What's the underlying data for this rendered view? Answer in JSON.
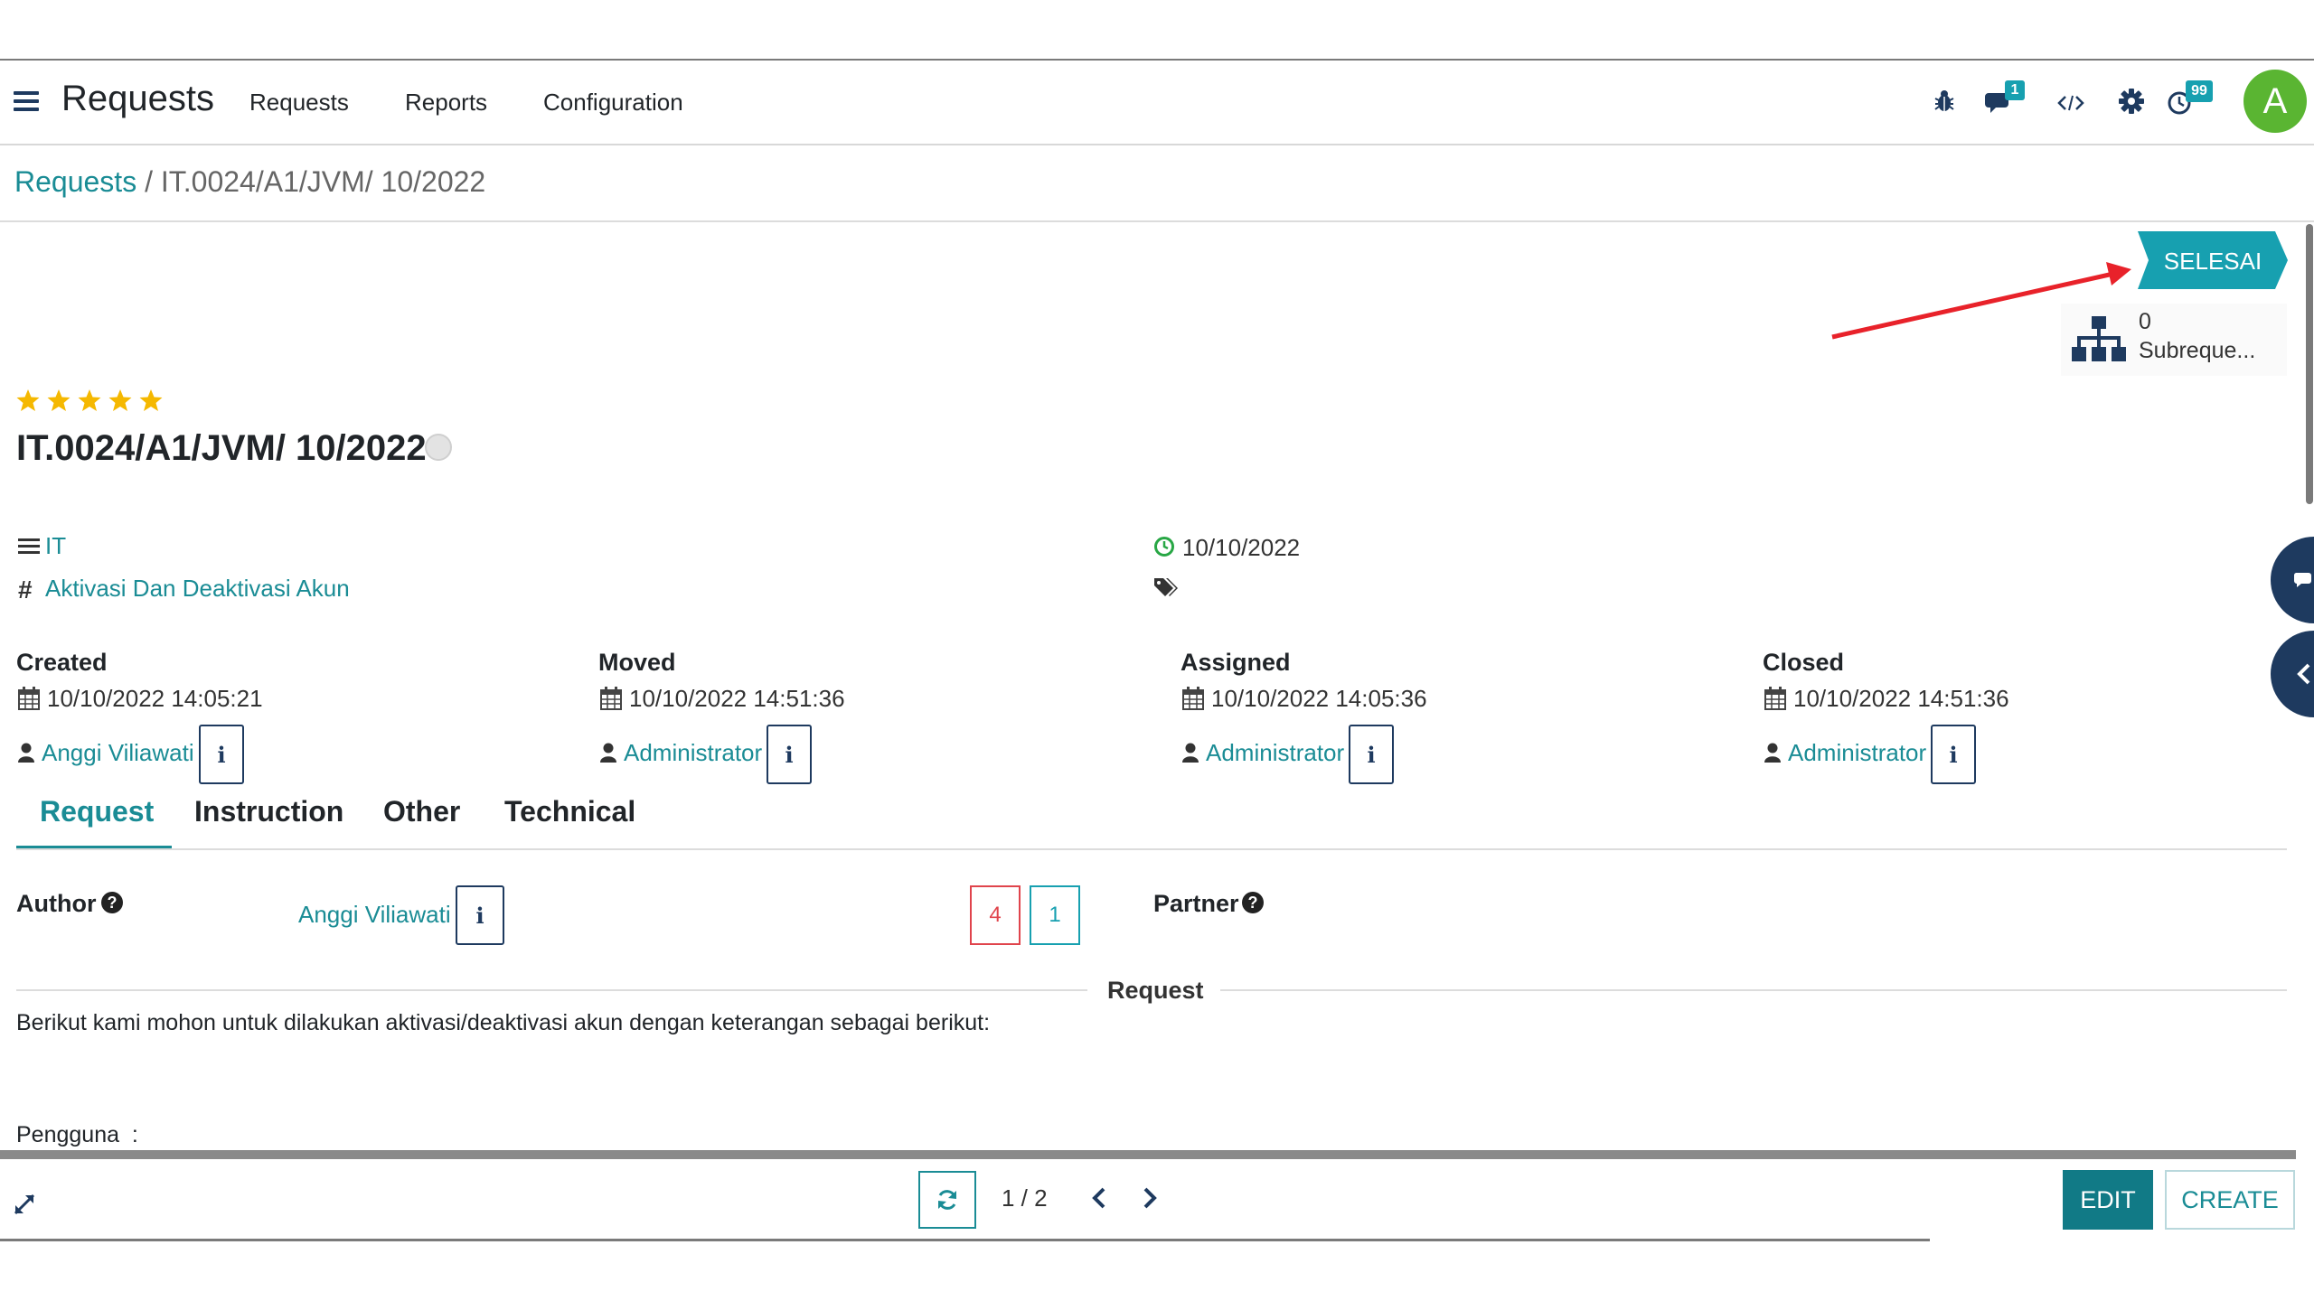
{
  "app": {
    "title": "Requests",
    "menu": [
      "Requests",
      "Reports",
      "Configuration"
    ],
    "chat_badge": "1",
    "activity_badge": "99",
    "avatar_letter": "A",
    "avatar_color": "#5ab532"
  },
  "breadcrumb": {
    "root": "Requests",
    "separator": " / ",
    "current": "IT.0024/A1/JVM/ 10/2022"
  },
  "status": {
    "stage": "SELESAI",
    "stage_color": "#17a0b0"
  },
  "subrequests": {
    "count": "0",
    "label": "Subreque..."
  },
  "record": {
    "rating_stars": 5,
    "title": "IT.0024/A1/JVM/ 10/2022",
    "category": "IT",
    "type": "Aktivasi Dan Deaktivasi Akun",
    "deadline": "10/10/2022"
  },
  "timeline": [
    {
      "label": "Created",
      "date": "10/10/2022 14:05:21",
      "user": "Anggi Viliawati"
    },
    {
      "label": "Moved",
      "date": "10/10/2022 14:51:36",
      "user": "Administrator"
    },
    {
      "label": "Assigned",
      "date": "10/10/2022 14:05:36",
      "user": "Administrator"
    },
    {
      "label": "Closed",
      "date": "10/10/2022 14:51:36",
      "user": "Administrator"
    }
  ],
  "tabs": [
    "Request",
    "Instruction",
    "Other",
    "Technical"
  ],
  "active_tab": "Request",
  "request_tab": {
    "author_label": "Author",
    "author": "Anggi Viliawati",
    "count_red": "4",
    "count_blue": "1",
    "partner_label": "Partner",
    "section_title": "Request",
    "body_line1": "Berikut kami mohon untuk dilakukan aktivasi/deaktivasi akun dengan keterangan sebagai berikut:",
    "body_line2": "Pengguna  :"
  },
  "pager": {
    "value": "1 / 2"
  },
  "buttons": {
    "edit": "EDIT",
    "create": "CREATE"
  },
  "annotation": {
    "arrow_color": "#e8222a"
  }
}
